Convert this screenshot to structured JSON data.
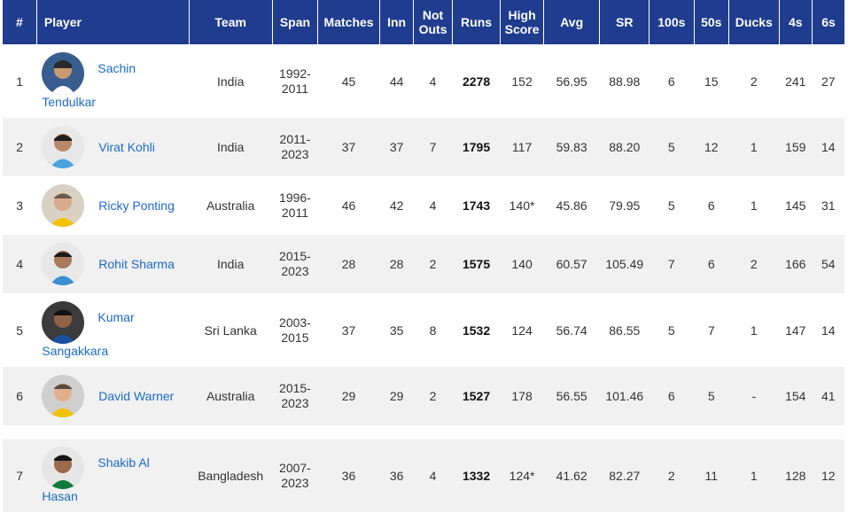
{
  "headers": {
    "rank": "#",
    "player": "Player",
    "team": "Team",
    "span": "Span",
    "matches": "Matches",
    "inn": "Inn",
    "not_outs_1": "Not",
    "not_outs_2": "Outs",
    "runs": "Runs",
    "high_score_1": "High",
    "high_score_2": "Score",
    "avg": "Avg",
    "sr": "SR",
    "hundreds": "100s",
    "fifties": "50s",
    "ducks": "Ducks",
    "fours": "4s",
    "sixes": "6s"
  },
  "rows": [
    {
      "rank": "1",
      "name_1": "Sachin",
      "name_2": "Tendulkar",
      "team": "India",
      "span_1": "1992-",
      "span_2": "2011",
      "matches": "45",
      "inn": "44",
      "not_outs": "4",
      "runs": "2278",
      "high_score": "152",
      "avg": "56.95",
      "sr": "88.98",
      "hundreds": "6",
      "fifties": "15",
      "ducks": "2",
      "fours": "241",
      "sixes": "27"
    },
    {
      "rank": "2",
      "name_1": "Virat Kohli",
      "team": "India",
      "span_1": "2011-",
      "span_2": "2023",
      "matches": "37",
      "inn": "37",
      "not_outs": "7",
      "runs": "1795",
      "high_score": "117",
      "avg": "59.83",
      "sr": "88.20",
      "hundreds": "5",
      "fifties": "12",
      "ducks": "1",
      "fours": "159",
      "sixes": "14"
    },
    {
      "rank": "3",
      "name_1": "Ricky Ponting",
      "team": "Australia",
      "span_1": "1996-",
      "span_2": "2011",
      "matches": "46",
      "inn": "42",
      "not_outs": "4",
      "runs": "1743",
      "high_score": "140*",
      "avg": "45.86",
      "sr": "79.95",
      "hundreds": "5",
      "fifties": "6",
      "ducks": "1",
      "fours": "145",
      "sixes": "31"
    },
    {
      "rank": "4",
      "name_1": "Rohit Sharma",
      "team": "India",
      "span_1": "2015-",
      "span_2": "2023",
      "matches": "28",
      "inn": "28",
      "not_outs": "2",
      "runs": "1575",
      "high_score": "140",
      "avg": "60.57",
      "sr": "105.49",
      "hundreds": "7",
      "fifties": "6",
      "ducks": "2",
      "fours": "166",
      "sixes": "54"
    },
    {
      "rank": "5",
      "name_1": "Kumar",
      "name_2": "Sangakkara",
      "team": "Sri Lanka",
      "span_1": "2003-",
      "span_2": "2015",
      "matches": "37",
      "inn": "35",
      "not_outs": "8",
      "runs": "1532",
      "high_score": "124",
      "avg": "56.74",
      "sr": "86.55",
      "hundreds": "5",
      "fifties": "7",
      "ducks": "1",
      "fours": "147",
      "sixes": "14"
    },
    {
      "rank": "6",
      "name_1": "David Warner",
      "team": "Australia",
      "span_1": "2015-",
      "span_2": "2023",
      "matches": "29",
      "inn": "29",
      "not_outs": "2",
      "runs": "1527",
      "high_score": "178",
      "avg": "56.55",
      "sr": "101.46",
      "hundreds": "6",
      "fifties": "5",
      "ducks": "-",
      "fours": "154",
      "sixes": "41"
    },
    {
      "rank": "7",
      "name_1": "Shakib Al",
      "name_2": "Hasan",
      "team": "Bangladesh",
      "span_1": "2007-",
      "span_2": "2023",
      "matches": "36",
      "inn": "36",
      "not_outs": "4",
      "runs": "1332",
      "high_score": "124*",
      "avg": "41.62",
      "sr": "82.27",
      "hundreds": "2",
      "fifties": "11",
      "ducks": "1",
      "fours": "128",
      "sixes": "12"
    }
  ],
  "colors": {
    "header_bg": "#1f3c8f",
    "link": "#1b6ac9",
    "row_alt": "#f1f1f1"
  }
}
